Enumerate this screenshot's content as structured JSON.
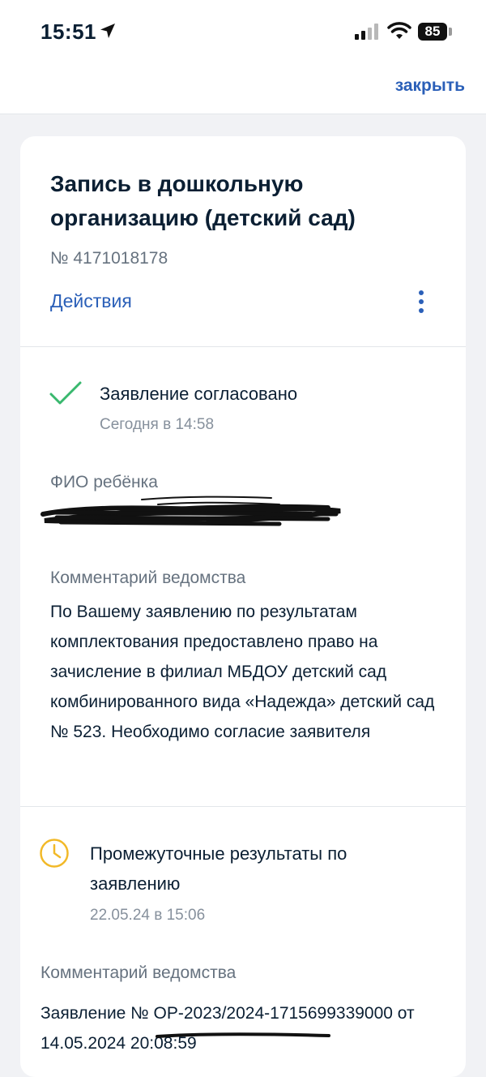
{
  "status_bar": {
    "time": "15:51",
    "battery": "85"
  },
  "topbar": {
    "close_label": "закрыть"
  },
  "card": {
    "title": "Запись в дошкольную организацию (детский сад)",
    "number": "№ 4171018178",
    "actions_label": "Действия"
  },
  "events": [
    {
      "status": "Заявление согласовано",
      "date": "Сегодня в 14:58",
      "child_label": "ФИО ребёнка",
      "comment_label": "Комментарий ведомства",
      "comment": "По Вашему заявлению по результатам комплектования предоставлено право на зачисление в филиал МБДОУ детский сад комбинированного вида «Надежда» детский сад № 523. Необходимо согласие заявителя"
    },
    {
      "status": "Промежуточные результаты по заявлению",
      "date": "22.05.24 в 15:06",
      "comment_label": "Комментарий ведомства",
      "comment": "Заявление № ОР-2023/2024-1715699339000 от 14.05.2024 20:08:59"
    }
  ],
  "colors": {
    "accent": "#2a5fb8",
    "success": "#39b86e",
    "warning": "#f2b928"
  }
}
